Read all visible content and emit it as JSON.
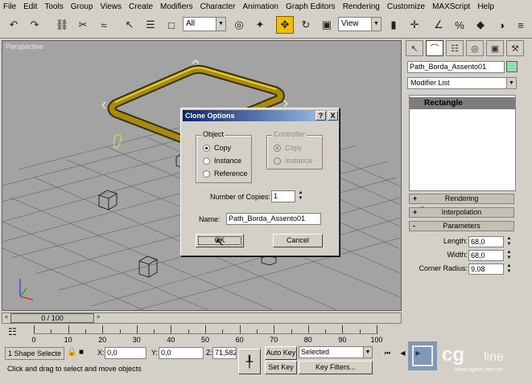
{
  "menu": [
    "File",
    "Edit",
    "Tools",
    "Group",
    "Views",
    "Create",
    "Modifiers",
    "Character",
    "Animation",
    "Graph Editors",
    "Rendering",
    "Customize",
    "MAXScript",
    "Help"
  ],
  "toolbar": {
    "selection_filter": "All",
    "ref_coord": "View"
  },
  "viewport": {
    "label": "Perspective"
  },
  "command_panel": {
    "object_name": "Path_Borda_Assento01",
    "object_color": "#8fe0a8",
    "modifier_list": "Modifier List",
    "stack_item": "Rectangle",
    "rollouts": {
      "rendering": "Rendering",
      "interpolation": "Interpolation",
      "parameters": "Parameters",
      "plus": "+",
      "minus": "-"
    },
    "params": {
      "length_label": "Length:",
      "length_value": "68,0",
      "width_label": "Width:",
      "width_value": "68,0",
      "radius_label": "Corner Radius:",
      "radius_value": "9,08"
    }
  },
  "dialog": {
    "title": "Clone Options",
    "help": "?",
    "close": "X",
    "object_group": "Object",
    "copy": "Copy",
    "instance": "Instance",
    "reference": "Reference",
    "controller_group": "Controller",
    "ctrl_copy": "Copy",
    "ctrl_instance": "Instance",
    "copies_label": "Number of Copies:",
    "copies_value": "1",
    "name_label": "Name:",
    "name_value": "Path_Borda_Assento01",
    "ok": "OK",
    "cancel": "Cancel"
  },
  "timeline": {
    "slider": "0 / 100",
    "ticks": [
      "0",
      "10",
      "20",
      "30",
      "40",
      "50",
      "60",
      "70",
      "80",
      "90",
      "100"
    ]
  },
  "status": {
    "selection": "1 Shape Selecte",
    "x_label": "X:",
    "x_value": "0,0",
    "y_label": "Y:",
    "y_value": "0,0",
    "z_label": "Z:",
    "z_value": "71,582",
    "auto_key": "Auto Key",
    "key_mode": "Selected",
    "set_key": "Set Key",
    "key_filters": "Key Filters...",
    "prompt": "Click and drag to select and move objects"
  },
  "watermark": {
    "brand": "cg",
    "site": "www.cgline.com.cn"
  }
}
